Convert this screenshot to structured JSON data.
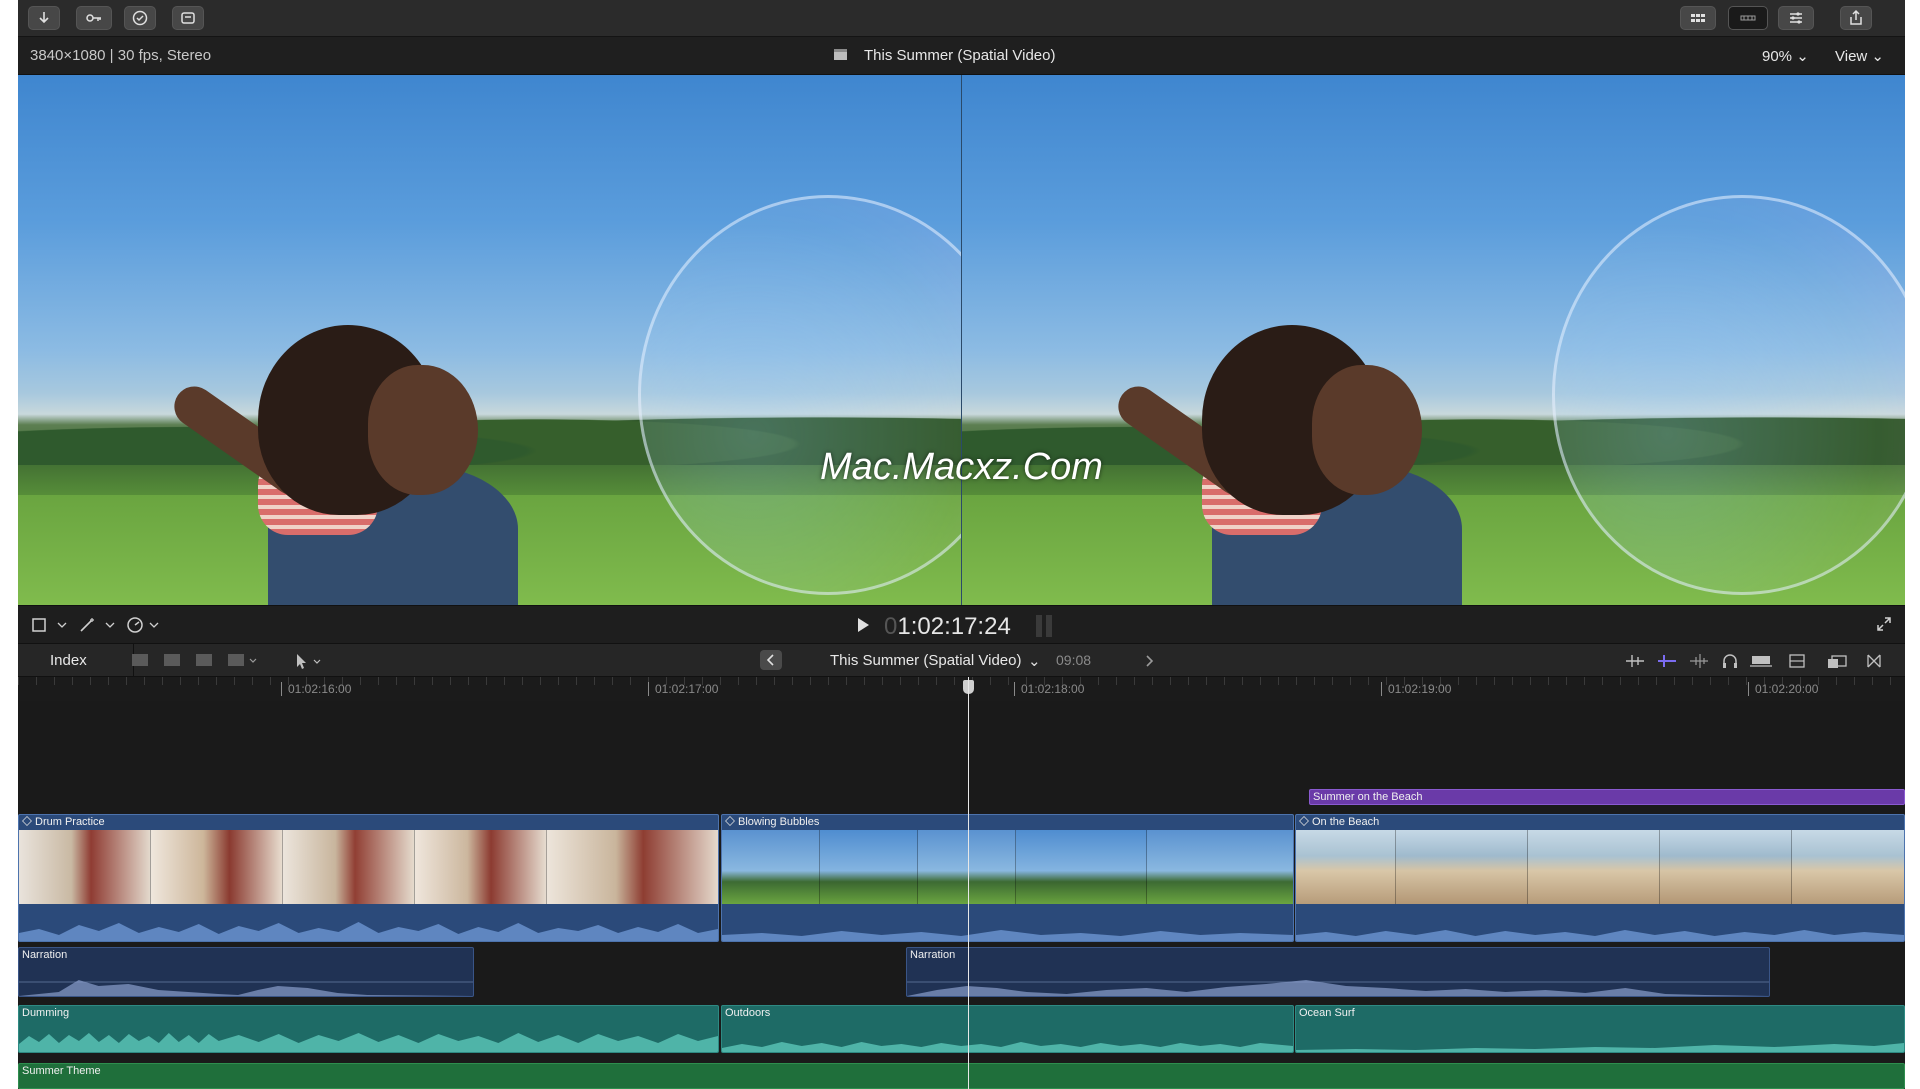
{
  "viewer": {
    "format": "3840×1080 | 30 fps, Stereo",
    "project_title": "This Summer (Spatial Video)",
    "zoom": "90%",
    "view_menu": "View",
    "watermark": "Mac.Macxz.Com"
  },
  "transport": {
    "timecode_dim": "0",
    "timecode": "1:02:17:24"
  },
  "timeline_header": {
    "index_label": "Index",
    "project_title": "This Summer (Spatial Video)",
    "duration": "09:08"
  },
  "ruler": {
    "ticks": [
      "01:02:16:00",
      "01:02:17:00",
      "01:02:18:00",
      "01:02:19:00",
      "01:02:20:00"
    ]
  },
  "clips": {
    "title": "Summer on the Beach",
    "video": [
      "Drum Practice",
      "Blowing Bubbles",
      "On the Beach"
    ],
    "narration": [
      "Narration",
      "Narration"
    ],
    "music": [
      "Dumming",
      "Outdoors",
      "Ocean Surf"
    ],
    "theme": "Summer Theme"
  },
  "icons": {
    "toolbar_left": [
      "import-icon",
      "keyword-icon",
      "checkmark-icon",
      "tag-icon"
    ],
    "toolbar_right": [
      "browser-grid-icon",
      "timeline-icon",
      "inspector-icon",
      "share-icon"
    ]
  },
  "colors": {
    "video_clip": "#2b4a7a",
    "narration_clip": "#203254",
    "music_clip": "#1e6b66",
    "theme_clip": "#1f6f3b",
    "title_clip": "#6a3aa8"
  }
}
